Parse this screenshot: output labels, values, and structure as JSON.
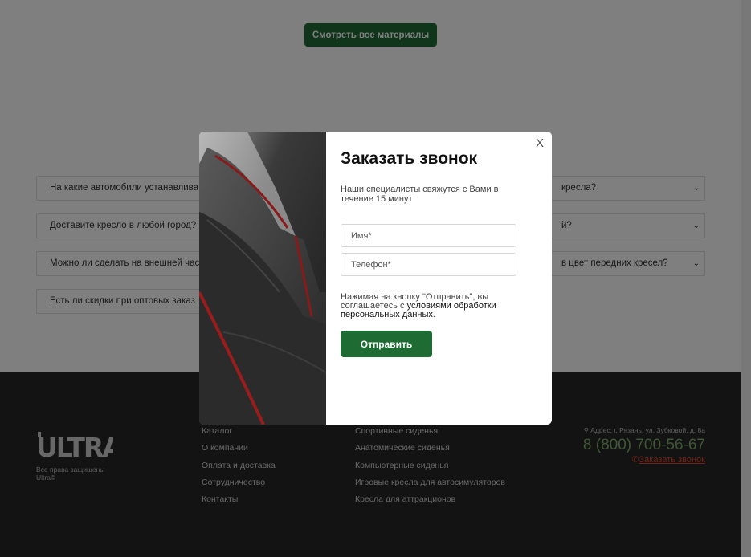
{
  "materials_button": "Смотреть все материалы",
  "faq": [
    {
      "left": "На какие автомобили устанавлива",
      "right": "кресла?"
    },
    {
      "left": "Доставите кресло в любой город?",
      "right": "й?"
    },
    {
      "left": "Можно ли сделать на внешней час",
      "right": "в цвет передних кресел?"
    },
    {
      "left": "Есть ли скидки при оптовых заказ",
      "right": ""
    }
  ],
  "footer": {
    "logo_text": "ULTRA",
    "copyright_line1": "Все права защищены",
    "copyright_line2": "Ultra©",
    "col1": [
      "Каталог",
      "О компании",
      "Оплата и доставка",
      "Сотрудничество",
      "Контакты"
    ],
    "col2": [
      "Спортивные сиденья",
      "Анатомические сиденья",
      "Компьютерные сиденья",
      "Игровые кресла для автосимуляторов",
      "Кресла для аттракционов"
    ],
    "address": "Адрес: г. Рязань, ул. Зубковой, д. 8а",
    "phone": "8 (800) 700-56-67",
    "callback": "Заказать звонок"
  },
  "modal": {
    "close": "X",
    "title": "Заказать звонок",
    "subtitle": "Наши специалисты свяжутся с Вами в течение 15 минут",
    "name_placeholder": "Имя*",
    "phone_placeholder": "Телефон*",
    "agree_text": "Нажимая на кнопку \"Отправить\", вы соглашаетесь с",
    "agree_link": "условиями обработки персональных данных",
    "agree_end": ".",
    "submit": "Отправить"
  },
  "colors": {
    "accent": "#1f6b34",
    "phone": "#7fae6a",
    "callback": "#e0492e",
    "footer_bg": "#262626"
  }
}
